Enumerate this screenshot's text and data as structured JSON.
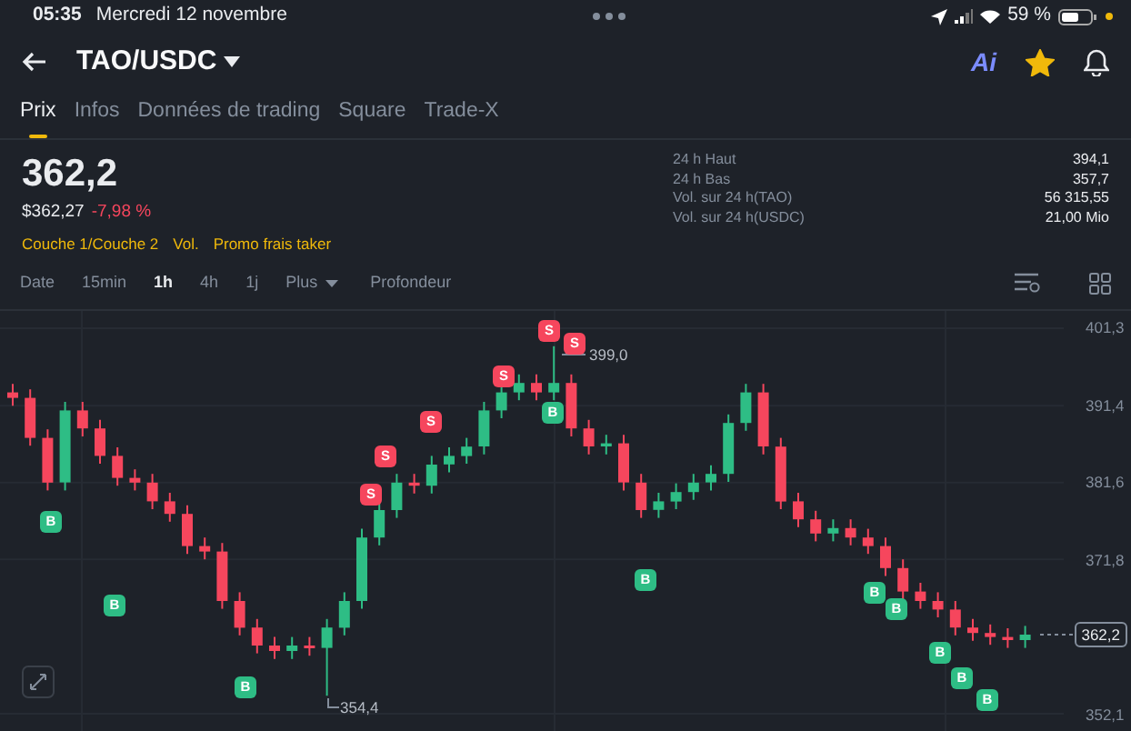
{
  "status_bar": {
    "time": "05:35",
    "date": "Mercredi 12 novembre",
    "battery": "59 %"
  },
  "header": {
    "pair": "TAO/USDC",
    "ai_label": "Ai",
    "favorite": true
  },
  "tabs": [
    {
      "label": "Prix",
      "selected": true
    },
    {
      "label": "Infos",
      "selected": false
    },
    {
      "label": "Données de trading",
      "selected": false
    },
    {
      "label": "Square",
      "selected": false
    },
    {
      "label": "Trade-X",
      "selected": false
    }
  ],
  "price": {
    "last": "362,2",
    "usd": "$362,27",
    "change": "-7,98 %"
  },
  "tags": [
    "Couche 1/Couche 2",
    "Vol.",
    "Promo frais taker"
  ],
  "stats": [
    {
      "label": "24 h Haut",
      "value": "394,1"
    },
    {
      "label": "24 h Bas",
      "value": "357,7"
    },
    {
      "label": "Vol. sur 24 h(TAO)",
      "value": "56 315,55"
    },
    {
      "label": "Vol. sur 24 h(USDC)",
      "value": "21,00 Mio"
    }
  ],
  "intervals": [
    {
      "label": "Date",
      "selected": false,
      "kind": "plain"
    },
    {
      "label": "15min",
      "selected": false,
      "kind": "plain"
    },
    {
      "label": "1h",
      "selected": true,
      "kind": "plain"
    },
    {
      "label": "4h",
      "selected": false,
      "kind": "plain"
    },
    {
      "label": "1j",
      "selected": false,
      "kind": "plain"
    },
    {
      "label": "Plus",
      "selected": false,
      "kind": "dropdown"
    },
    {
      "label": "Profondeur",
      "selected": false,
      "kind": "plain"
    }
  ],
  "chart": {
    "current_price": "362,2",
    "high_label": "399,0",
    "low_label": "354,4",
    "markers": [
      {
        "label": "B",
        "kind": "buy"
      },
      {
        "label": "B",
        "kind": "buy"
      },
      {
        "label": "B",
        "kind": "buy"
      },
      {
        "label": "B",
        "kind": "buy"
      },
      {
        "label": "B",
        "kind": "buy"
      },
      {
        "label": "B",
        "kind": "buy"
      },
      {
        "label": "B",
        "kind": "buy"
      },
      {
        "label": "B",
        "kind": "buy"
      },
      {
        "label": "B",
        "kind": "buy"
      },
      {
        "label": "B",
        "kind": "buy"
      },
      {
        "label": "S",
        "kind": "sell"
      },
      {
        "label": "S",
        "kind": "sell"
      },
      {
        "label": "S",
        "kind": "sell"
      },
      {
        "label": "S",
        "kind": "sell"
      },
      {
        "label": "S",
        "kind": "sell"
      },
      {
        "label": "S",
        "kind": "sell"
      }
    ],
    "chart_data": {
      "type": "candlestick",
      "grid": true,
      "ylim": [
        349.9,
        403.5
      ],
      "yticks": [
        {
          "value": 401.3,
          "label": "401,3"
        },
        {
          "value": 391.4,
          "label": "391,4"
        },
        {
          "value": 381.6,
          "label": "381,6"
        },
        {
          "value": 371.8,
          "label": "371,8"
        },
        {
          "value": 352.1,
          "label": "352,1"
        }
      ],
      "ohlc": [
        [
          393.1,
          394.2,
          391.4,
          392.4
        ],
        [
          392.4,
          393.5,
          386.3,
          387.3
        ],
        [
          387.3,
          388.4,
          380.6,
          381.6
        ],
        [
          381.6,
          391.9,
          380.6,
          390.8
        ],
        [
          390.8,
          391.9,
          387.5,
          388.5
        ],
        [
          388.5,
          389.6,
          384.0,
          385.0
        ],
        [
          385.0,
          386.1,
          381.2,
          382.2
        ],
        [
          382.2,
          383.3,
          380.6,
          381.6
        ],
        [
          381.6,
          382.7,
          378.2,
          379.2
        ],
        [
          379.2,
          380.3,
          376.6,
          377.6
        ],
        [
          377.6,
          378.7,
          372.5,
          373.5
        ],
        [
          373.5,
          374.6,
          371.8,
          372.8
        ],
        [
          372.8,
          373.9,
          365.5,
          366.5
        ],
        [
          366.5,
          367.6,
          362.1,
          363.1
        ],
        [
          363.1,
          364.2,
          359.8,
          360.8
        ],
        [
          360.8,
          361.9,
          359.1,
          360.1
        ],
        [
          360.1,
          361.9,
          359.1,
          360.8
        ],
        [
          360.8,
          361.9,
          359.5,
          360.5
        ],
        [
          360.5,
          364.2,
          354.4,
          363.1
        ],
        [
          363.1,
          367.6,
          362.1,
          366.5
        ],
        [
          366.5,
          375.7,
          365.5,
          374.6
        ],
        [
          374.6,
          379.2,
          373.6,
          378.1
        ],
        [
          378.1,
          382.7,
          377.1,
          381.6
        ],
        [
          381.6,
          382.7,
          380.2,
          381.2
        ],
        [
          381.2,
          385.0,
          380.2,
          383.9
        ],
        [
          383.9,
          386.1,
          382.9,
          385.0
        ],
        [
          385.0,
          387.3,
          384.0,
          386.2
        ],
        [
          386.2,
          391.9,
          385.2,
          390.8
        ],
        [
          390.8,
          394.2,
          389.8,
          393.1
        ],
        [
          393.1,
          395.4,
          392.1,
          394.3
        ],
        [
          394.3,
          395.4,
          392.1,
          393.1
        ],
        [
          393.1,
          399.0,
          392.1,
          394.3
        ],
        [
          394.3,
          395.4,
          387.5,
          388.5
        ],
        [
          388.5,
          389.6,
          385.2,
          386.2
        ],
        [
          386.2,
          387.7,
          385.2,
          386.6
        ],
        [
          386.6,
          387.7,
          380.6,
          381.6
        ],
        [
          381.6,
          382.7,
          377.1,
          378.1
        ],
        [
          378.1,
          380.3,
          377.1,
          379.2
        ],
        [
          379.2,
          381.5,
          378.2,
          380.4
        ],
        [
          380.4,
          382.7,
          379.4,
          381.6
        ],
        [
          381.6,
          383.8,
          380.6,
          382.7
        ],
        [
          382.7,
          390.3,
          381.7,
          389.2
        ],
        [
          389.2,
          394.2,
          388.2,
          393.1
        ],
        [
          393.1,
          394.2,
          385.2,
          386.2
        ],
        [
          386.2,
          387.3,
          378.2,
          379.2
        ],
        [
          379.2,
          380.3,
          375.9,
          376.9
        ],
        [
          376.9,
          378.0,
          374.1,
          375.1
        ],
        [
          375.1,
          376.9,
          374.1,
          375.8
        ],
        [
          375.8,
          376.9,
          373.6,
          374.6
        ],
        [
          374.6,
          375.7,
          372.5,
          373.5
        ],
        [
          373.5,
          374.6,
          369.7,
          370.7
        ],
        [
          370.7,
          371.8,
          366.7,
          367.7
        ],
        [
          367.7,
          368.8,
          365.5,
          366.5
        ],
        [
          366.5,
          367.6,
          364.4,
          365.4
        ],
        [
          365.4,
          366.5,
          362.1,
          363.1
        ],
        [
          363.1,
          364.2,
          361.4,
          362.4
        ],
        [
          362.4,
          363.5,
          360.9,
          361.9
        ],
        [
          361.9,
          363.0,
          360.5,
          361.5
        ],
        [
          361.5,
          363.3,
          360.5,
          362.2
        ]
      ]
    }
  }
}
